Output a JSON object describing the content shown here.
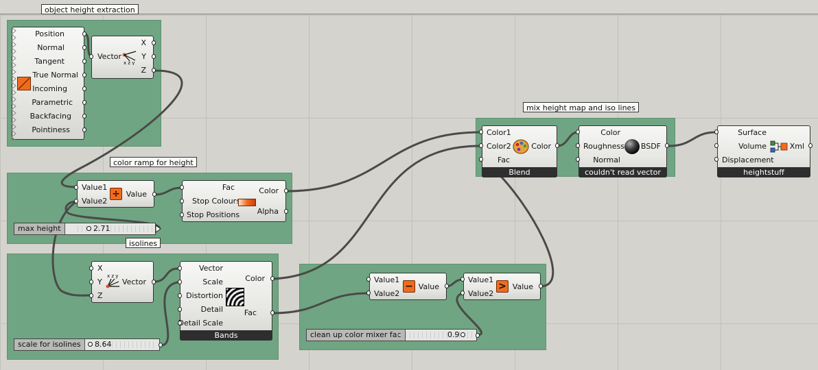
{
  "colors": {
    "canvas": "#d5d3ce",
    "group": "#6fa582",
    "wire": "#4a4a48",
    "operator": "#f26b1d"
  },
  "groups": {
    "height_extraction": "object height extraction",
    "color_ramp": "color ramp for height",
    "isolines": "isolines",
    "mix": "mix height map and iso lines"
  },
  "geometry": {
    "outputs": [
      "Position",
      "Normal",
      "Tangent",
      "True Normal",
      "Incoming",
      "Parametric",
      "Backfacing",
      "Pointiness"
    ]
  },
  "separate_xyz": {
    "input": "Vector",
    "outputs": [
      "X",
      "Y",
      "Z"
    ]
  },
  "divide": {
    "inputs": [
      "Value1",
      "Value2"
    ],
    "output": "Value",
    "symbol": "÷"
  },
  "color_ramp": {
    "inputs": [
      "Fac",
      "Stop Colours",
      "Stop Positions"
    ],
    "outputs": [
      "Color",
      "Alpha"
    ]
  },
  "max_height": {
    "name": "max height",
    "value": "2.71"
  },
  "combine_xyz": {
    "inputs": [
      "X",
      "Y",
      "Z"
    ],
    "output": "Vector"
  },
  "bands": {
    "inputs": [
      "Vector",
      "Scale",
      "Distortion",
      "Detail",
      "Detail Scale"
    ],
    "outputs": [
      "Color",
      "Fac"
    ],
    "title": "Bands"
  },
  "iso_scale": {
    "name": "scale for isolines",
    "value": "8.64"
  },
  "subtract": {
    "inputs": [
      "Value1",
      "Value2"
    ],
    "output": "Value",
    "symbol": "−"
  },
  "greater": {
    "inputs": [
      "Value1",
      "Value2"
    ],
    "output": "Value",
    "symbol": ">"
  },
  "cleanup": {
    "name": "clean up color mixer fac",
    "value": "0.9"
  },
  "blend": {
    "inputs": [
      "Color1",
      "Color2",
      "Fac"
    ],
    "output": "Color",
    "title": "Blend"
  },
  "bsdf": {
    "inputs": [
      "Color",
      "Roughness",
      "Normal"
    ],
    "output": "BSDF",
    "title": "couldn't read vector"
  },
  "output_node": {
    "inputs": [
      "Surface",
      "Volume",
      "Displacement"
    ],
    "output": "Xml",
    "title": "heightstuff"
  }
}
